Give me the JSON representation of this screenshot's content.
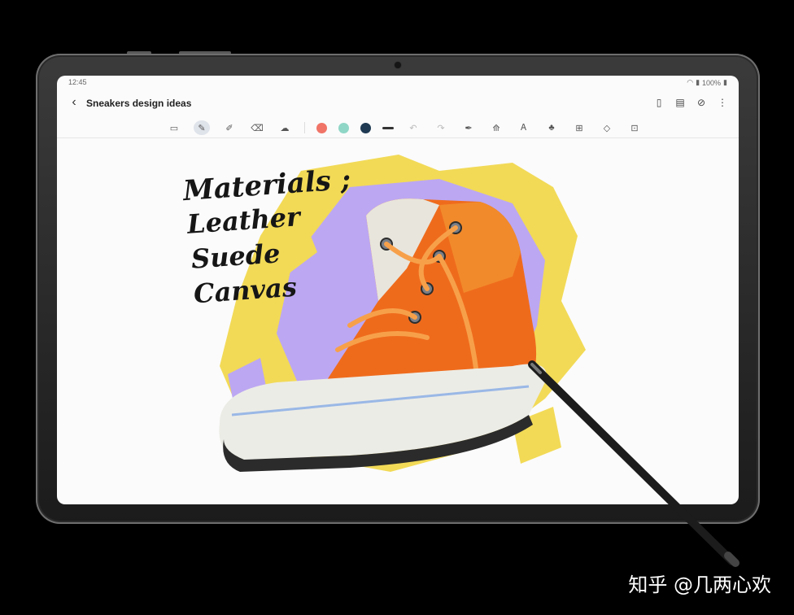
{
  "status": {
    "time": "12:45",
    "battery": "100%"
  },
  "header": {
    "title": "Sneakers design ideas"
  },
  "toolbar": {
    "tools": [
      "keyboard-icon",
      "pen-icon",
      "highlighter-icon",
      "eraser-icon",
      "lasso-icon"
    ],
    "colors": [
      "#f07467",
      "#8fd6c6",
      "#1f3a52"
    ],
    "actions": [
      "undo-icon",
      "redo-icon",
      "pen-settings-icon",
      "text-icon",
      "shape-icon",
      "fill-icon",
      "insert-icon",
      "template-icon",
      "lock-icon"
    ]
  },
  "note": {
    "lines": [
      "Materials ;",
      "Leather",
      "Suede",
      "Canvas"
    ]
  },
  "watermark": "知乎 @几两心欢"
}
